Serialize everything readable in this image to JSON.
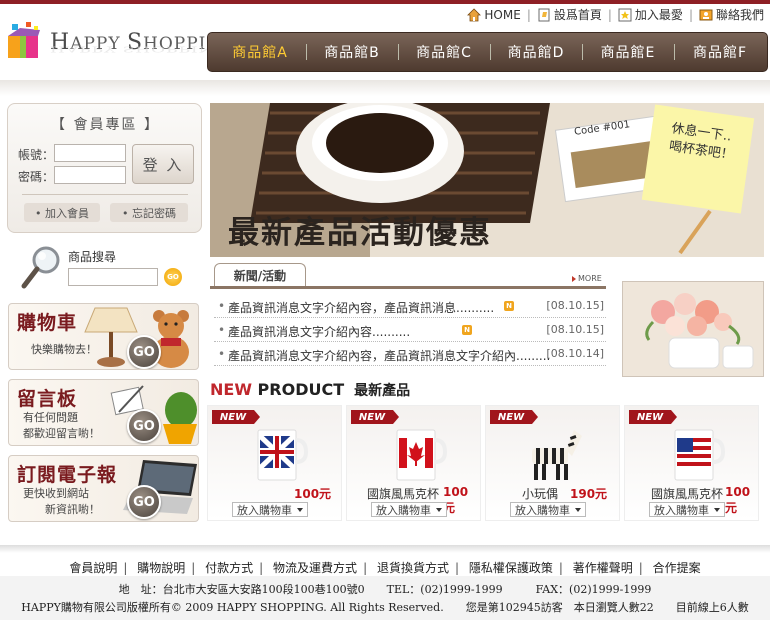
{
  "brand": {
    "name_part1_cap": "H",
    "name_part1": "APPY ",
    "name_part2_cap": "S",
    "name_part2": "HOPPING"
  },
  "toplinks": [
    {
      "label": "HOME",
      "icon": "home-icon"
    },
    {
      "label": "設爲首頁",
      "icon": "page-icon"
    },
    {
      "label": "加入最愛",
      "icon": "star-icon"
    },
    {
      "label": "聯絡我們",
      "icon": "contact-icon"
    }
  ],
  "nav": [
    "商品館A",
    "商品館B",
    "商品館C",
    "商品館D",
    "商品館E",
    "商品館F"
  ],
  "member": {
    "title": "【 會員專區 】",
    "account_label": "帳號：",
    "password_label": "密碼：",
    "login_label": "登 入",
    "join_label": "• 加入會員",
    "forgot_label": "• 忘記密碼"
  },
  "search": {
    "label": "商品搜尋",
    "go": "GO"
  },
  "side_banners": [
    {
      "title": "購物車",
      "sub1": "快樂購物去！",
      "sub2": "",
      "go": "GO"
    },
    {
      "title": "留言板",
      "sub1": "有任何問題",
      "sub2": "都歡迎留言喲！",
      "go": "GO"
    },
    {
      "title": "訂閱電子報",
      "sub1": "更快收到網站",
      "sub2": "新資訊喲！",
      "go": "GO"
    }
  ],
  "hero": {
    "title": "最新產品活動優惠",
    "note": "休息一下..喝杯茶吧！",
    "card_code": "Code #001"
  },
  "news": {
    "tab": "新聞/活動",
    "more": "MORE",
    "items": [
      {
        "text": "產品資訊消息文字介紹內容，產品資訊消息..........",
        "date": "[08.10.15]",
        "new": "N"
      },
      {
        "text": "產品資訊消息文字介紹內容..........",
        "date": "[08.10.15]",
        "new": "N"
      },
      {
        "text": "產品資訊消息文字介紹內容，產品資訊消息文字介紹內.........",
        "date": "[08.10.14]",
        "new": ""
      }
    ]
  },
  "new_product": {
    "head_new": "NEW",
    "head_product": " PRODUCT",
    "head_zh": "最新產品",
    "tag": "NEW",
    "cart_label": "放入購物車",
    "items": [
      {
        "name": "",
        "price": "100元",
        "image": "uk-flag-mug"
      },
      {
        "name": "國旗風馬克杯",
        "price": "100元",
        "image": "canada-flag-mug"
      },
      {
        "name": "小玩偶",
        "price": "190元",
        "image": "zebra-toy"
      },
      {
        "name": "國旗風馬克杯",
        "price": "100元",
        "image": "us-flag-mug"
      }
    ]
  },
  "footer": {
    "links": [
      "會員說明",
      "購物說明",
      "付款方式",
      "物流及運費方式",
      "退貨換貨方式",
      "隱私權保護政策",
      "著作權聲明",
      "合作提案"
    ],
    "address": "地　址：台北市大安區大安路100段100巷100號0　　TEL：(02)1999-1999　　　FAX：(02)1999-1999",
    "copyright": "HAPPY購物有限公司版權所有© 2009 HAPPY  SHOPPING. All Rights Reserved.　　您是第102945訪客　本日瀏覽人數22　　目前線上6人數"
  }
}
